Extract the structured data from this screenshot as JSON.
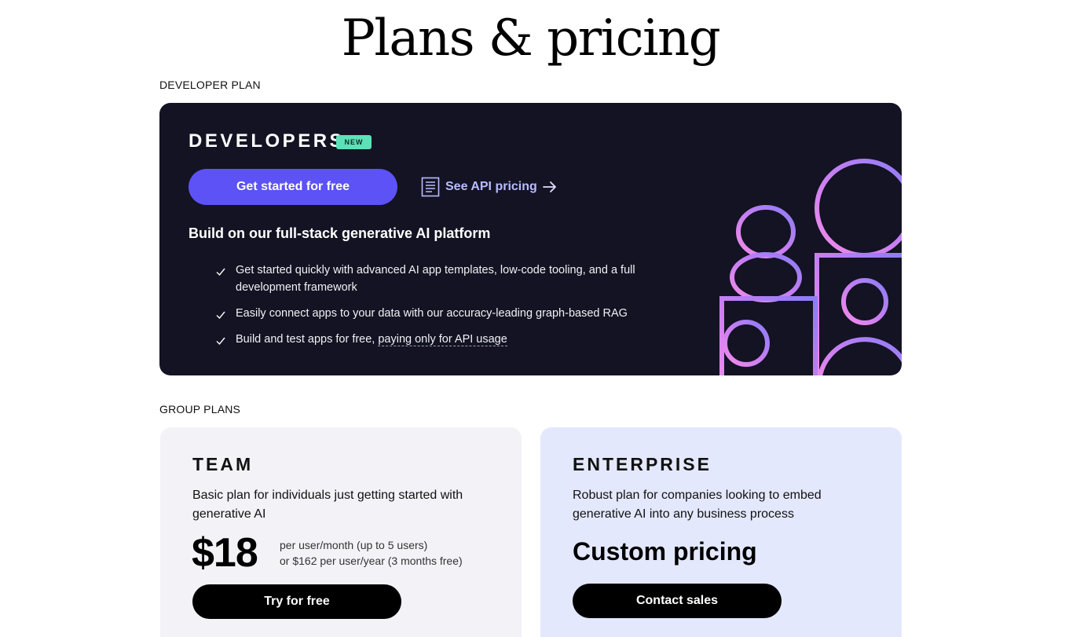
{
  "page": {
    "title": "Plans & pricing"
  },
  "developer_section": {
    "label": "DEVELOPER PLAN",
    "card": {
      "title": "DEVELOPERS",
      "badge": "NEW",
      "primary_button": "Get started for free",
      "api_link": "See API pricing",
      "subtitle": "Build on our full-stack generative AI platform",
      "features": [
        "Get started quickly with advanced AI app templates, low-code tooling, and a full development framework",
        "Easily connect apps to your data with our accuracy-leading graph-based RAG",
        {
          "text": "Build and test apps for free, ",
          "underlined": "paying only for API usage"
        }
      ],
      "icons": [
        "document-icon",
        "arrow-right-icon",
        "check-icon"
      ],
      "accent_color": "#5c52f5",
      "badge_color": "#5ee1b8",
      "background_color": "#131323"
    }
  },
  "group_section": {
    "label": "GROUP PLANS",
    "plans": [
      {
        "name": "TEAM",
        "description": "Basic plan for individuals just getting started with generative AI",
        "price": "$18",
        "price_notes": [
          "per user/month (up to 5 users)",
          "or $162 per user/year (3 months free)"
        ],
        "button": "Try for free",
        "background_color": "#f3f2f7"
      },
      {
        "name": "ENTERPRISE",
        "description": "Robust plan for companies looking to embed generative AI into any business process",
        "price": "Custom pricing",
        "button": "Contact sales",
        "background_color": "#e4e8fd"
      }
    ]
  }
}
